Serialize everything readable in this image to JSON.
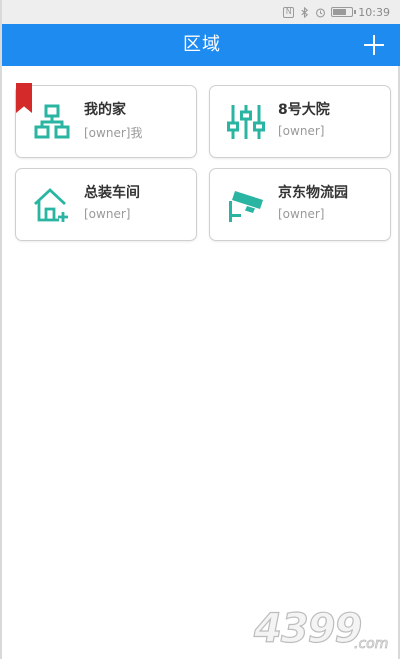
{
  "status_bar": {
    "time": "10:39",
    "icons": [
      "nfc-icon",
      "bluetooth-icon",
      "alarm-icon",
      "battery-icon"
    ]
  },
  "app_bar": {
    "title": "区域",
    "add_icon": "plus-icon"
  },
  "areas": [
    {
      "name": "我的家",
      "owner": "[owner]我",
      "icon": "network-icon",
      "bookmarked": true
    },
    {
      "name": "8号大院",
      "owner": "[owner]",
      "icon": "sliders-icon",
      "bookmarked": false
    },
    {
      "name": "总装车间",
      "owner": "[owner]",
      "icon": "house-plus-icon",
      "bookmarked": false
    },
    {
      "name": "京东物流园",
      "owner": "[owner]",
      "icon": "camera-icon",
      "bookmarked": false
    }
  ],
  "colors": {
    "app_bar": "#1e8bf0",
    "icon_teal": "#2ab5a3",
    "bookmark_red": "#d42a2a"
  },
  "watermark": {
    "brand": "4399",
    "domain": ".com"
  }
}
